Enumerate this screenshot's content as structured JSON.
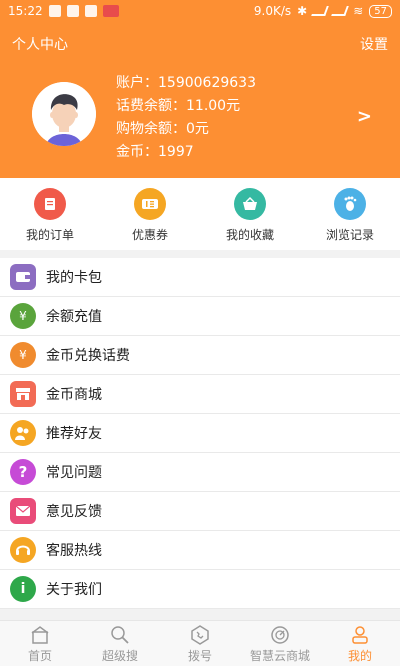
{
  "status_bar": {
    "time": "15:22",
    "network_speed": "9.0K/s",
    "battery": "57"
  },
  "header": {
    "title": "个人中心",
    "settings_label": "设置",
    "account": "账户：15900629633",
    "phone_balance": "话费余额：11.00元",
    "shopping_balance": "购物余额：0元",
    "coins": "金币：1997",
    "chevron": ">"
  },
  "quick_actions": [
    {
      "label": "我的订单",
      "icon": "order-icon",
      "color": "#f05a4a"
    },
    {
      "label": "优惠券",
      "icon": "coupon-icon",
      "color": "#f5a623"
    },
    {
      "label": "我的收藏",
      "icon": "basket-icon",
      "color": "#35b9a2"
    },
    {
      "label": "浏览记录",
      "icon": "footprint-icon",
      "color": "#4cb1e6"
    }
  ],
  "menu": [
    {
      "label": "我的卡包",
      "icon": "wallet-icon",
      "color": "#8c6dc1"
    },
    {
      "label": "余额充值",
      "icon": "money-bag-icon",
      "color": "#5aa43c"
    },
    {
      "label": "金币兑换话费",
      "icon": "coin-bag-icon",
      "color": "#f08b2e"
    },
    {
      "label": "金币商城",
      "icon": "store-icon",
      "color": "#f26b55"
    },
    {
      "label": "推荐好友",
      "icon": "friends-icon",
      "color": "#f5a623"
    },
    {
      "label": "常见问题",
      "icon": "question-icon",
      "color": "#c64bd6"
    },
    {
      "label": "意见反馈",
      "icon": "mail-icon",
      "color": "#e94c79"
    },
    {
      "label": "客服热线",
      "icon": "headset-icon",
      "color": "#f5a623"
    },
    {
      "label": "关于我们",
      "icon": "info-icon",
      "color": "#2ea84a"
    }
  ],
  "bottom_nav": [
    {
      "label": "首页",
      "icon": "home-icon",
      "active": false
    },
    {
      "label": "超级搜",
      "icon": "search-icon",
      "active": false
    },
    {
      "label": "拨号",
      "icon": "phone-icon",
      "active": false
    },
    {
      "label": "智慧云商城",
      "icon": "compass-icon",
      "active": false
    },
    {
      "label": "我的",
      "icon": "user-icon",
      "active": true
    }
  ],
  "colors": {
    "brand_orange": "#fd8f33",
    "inactive_gray": "#999999"
  }
}
